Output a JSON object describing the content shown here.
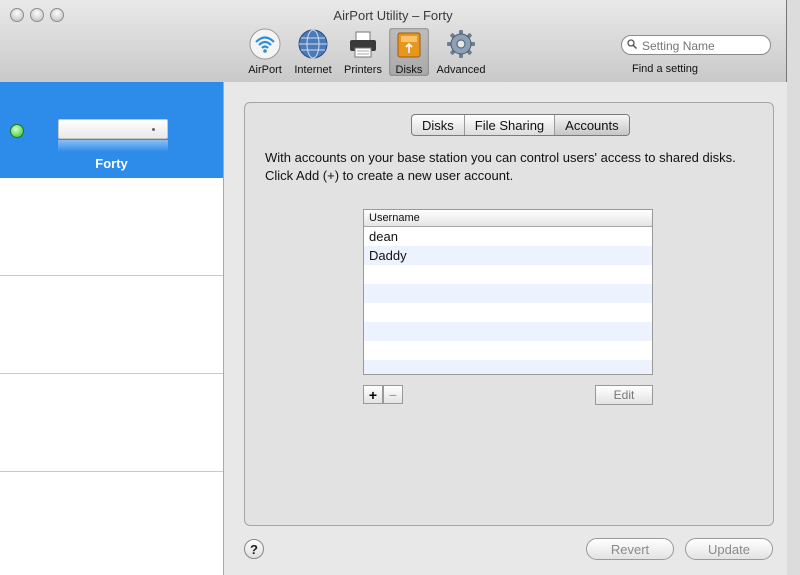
{
  "window": {
    "title": "AirPort Utility – Forty"
  },
  "toolbar": {
    "items": [
      {
        "label": "AirPort",
        "icon": "wifi-icon"
      },
      {
        "label": "Internet",
        "icon": "globe-icon"
      },
      {
        "label": "Printers",
        "icon": "printer-icon"
      },
      {
        "label": "Disks",
        "icon": "disk-icon",
        "selected": true
      },
      {
        "label": "Advanced",
        "icon": "gear-icon"
      }
    ],
    "search_placeholder": "Setting Name",
    "find_label": "Find a setting"
  },
  "sidebar": {
    "devices": [
      {
        "name": "Forty",
        "status": "green"
      }
    ]
  },
  "tabs": [
    {
      "label": "Disks"
    },
    {
      "label": "File Sharing"
    },
    {
      "label": "Accounts",
      "selected": true
    }
  ],
  "accounts": {
    "description": "With accounts on your base station you can control users' access to shared disks. Click Add (+) to create a new user account.",
    "table_header": "Username",
    "users": [
      "dean",
      "Daddy"
    ],
    "add_label": "+",
    "remove_label": "−",
    "edit_label": "Edit"
  },
  "footer": {
    "help_label": "?",
    "revert_label": "Revert",
    "update_label": "Update"
  },
  "colors": {
    "selection": "#2d8bea",
    "status_green": "#2fbf2b"
  }
}
